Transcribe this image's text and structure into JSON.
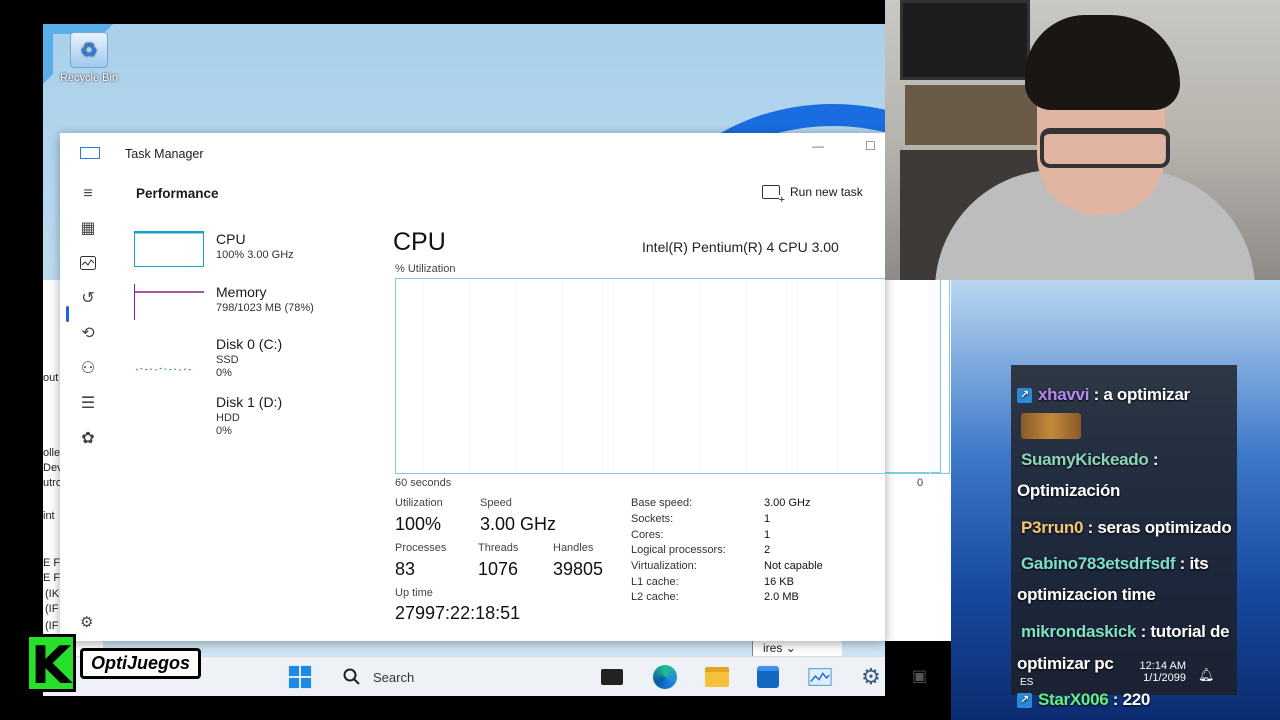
{
  "desktop": {
    "recycle_bin_label": "Recycle Bin",
    "bg_fragments": [
      "out",
      "olle",
      "Dev",
      "utro",
      "int",
      "E F",
      "E F",
      "(IK",
      "(IF",
      "(IF"
    ]
  },
  "taskmanager": {
    "title": "Task Manager",
    "section_title": "Performance",
    "run_new_task": "Run new task",
    "resources": [
      {
        "name": "CPU",
        "line2": "100% 3.00 GHz",
        "line3": "",
        "color": "#1b9fc4"
      },
      {
        "name": "Memory",
        "line2": "798/1023 MB (78%)",
        "line3": "",
        "color": "#8b1e8f"
      },
      {
        "name": "Disk 0 (C:)",
        "line2": "SSD",
        "line3": "0%",
        "color": "#2a9a2a"
      },
      {
        "name": "Disk 1 (D:)",
        "line2": "HDD",
        "line3": "0%",
        "color": "#2a9a2a"
      }
    ],
    "cpu": {
      "heading": "CPU",
      "model": "Intel(R) Pentium(R) 4 CPU 3.00",
      "util_label": "% Utilization",
      "graph_left_label": "60 seconds",
      "graph_right_label": "0",
      "utilization_label": "Utilization",
      "utilization": "100%",
      "speed_label": "Speed",
      "speed": "3.00 GHz",
      "processes_label": "Processes",
      "processes": "83",
      "threads_label": "Threads",
      "threads": "1076",
      "handles_label": "Handles",
      "handles": "39805",
      "uptime_label": "Up time",
      "uptime": "27997:22:18:51",
      "details": [
        {
          "k": "Base speed:",
          "v": "3.00 GHz"
        },
        {
          "k": "Sockets:",
          "v": "1"
        },
        {
          "k": "Cores:",
          "v": "1"
        },
        {
          "k": "Logical processors:",
          "v": "2"
        },
        {
          "k": "Virtualization:",
          "v": "Not capable"
        },
        {
          "k": "L1 cache:",
          "v": "16 KB"
        },
        {
          "k": "L2 cache:",
          "v": "2.0 MB"
        }
      ]
    },
    "nav_icons": [
      "hamburger-icon",
      "processes-icon",
      "performance-icon",
      "app-history-icon",
      "startup-apps-icon",
      "users-icon",
      "details-icon",
      "services-icon",
      "settings-icon"
    ]
  },
  "taskbar": {
    "search_placeholder": "Search",
    "lang_fragment": "ires"
  },
  "chat": {
    "messages": [
      {
        "user": "xhavvi",
        "text": " : a optimizar",
        "color": "#b48cf0"
      },
      {
        "user": "SuamyKickeado",
        "text": " :",
        "color": "#8ed6b8"
      },
      {
        "user": "",
        "text": "Optimización",
        "color": "#ffffff"
      },
      {
        "user": "P3rrun0",
        "text": " : seras optimizado",
        "color": "#f0c674"
      },
      {
        "user": "Gabino783etsdrfsdf",
        "text": " : its",
        "color": "#7fe0c8"
      },
      {
        "user": "",
        "text": "optimizacion time",
        "color": "#ffffff"
      },
      {
        "user": "mikrondaskick",
        "text": " : tutorial de",
        "color": "#7fe0c8"
      },
      {
        "user": "",
        "text": "optimizar pc",
        "color": "#ffffff"
      },
      {
        "user": "StarX006",
        "text": " : 220",
        "color": "#6cf07a"
      }
    ],
    "clock_time": "12:14 AM",
    "clock_date": "1/1/2099",
    "lang": "ES"
  },
  "logo": {
    "letter": "K",
    "text": "OptiJuegos"
  }
}
